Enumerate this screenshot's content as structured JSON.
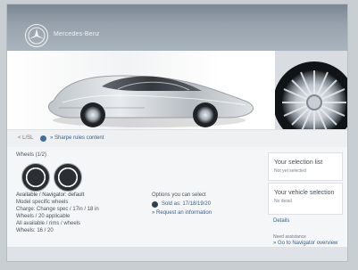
{
  "brand": {
    "name": "Mercedes-Benz"
  },
  "bar": {
    "tag": "< L/SL",
    "link_label": "» Sharpe rules content"
  },
  "left": {
    "section_title": "Wheels (1/2)",
    "lines": [
      "Available / Navigator: default",
      "Model specific wheels",
      "Charge: Change spec  /  17in  /  18 in",
      "Wheels / 20 applicable",
      "All available / rims / wheels",
      "Wheels: 16 / 20"
    ]
  },
  "mid": {
    "title": "Options you can select",
    "link1": "Sold as: 17/18/19/20",
    "link2": "» Request an information"
  },
  "right": {
    "card1": {
      "title": "Your selection list",
      "sub": "Not yet selected"
    },
    "card2": {
      "title": "Your vehicle selection",
      "sub": "No detail"
    },
    "details": "Details",
    "help_title": "Need assistance",
    "help_link": "» Go to Navigator overview"
  },
  "colors": {
    "header": "#8f9aa5",
    "link": "#355f8c",
    "bg": "#f5f6f7"
  }
}
